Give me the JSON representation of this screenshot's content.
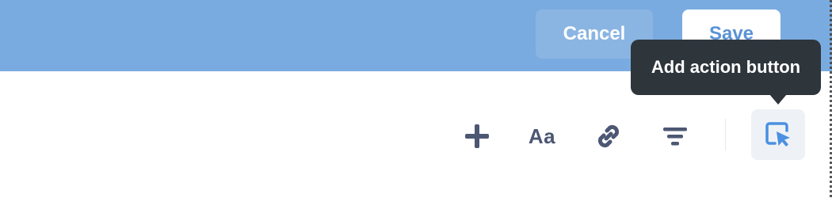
{
  "header": {
    "cancel_label": "Cancel",
    "save_label": "Save"
  },
  "tooltip": {
    "text": "Add action button"
  },
  "toolbar": {
    "items": [
      {
        "icon": "plus-icon"
      },
      {
        "icon": "text-icon",
        "glyph": "Aa"
      },
      {
        "icon": "link-icon"
      },
      {
        "icon": "filter-icon"
      },
      {
        "icon": "cursor-click-icon"
      }
    ]
  },
  "colors": {
    "header": "#7aabe0",
    "tooltip_bg": "#2e353b",
    "icon": "#4c5773",
    "accent": "#4a90e2"
  }
}
